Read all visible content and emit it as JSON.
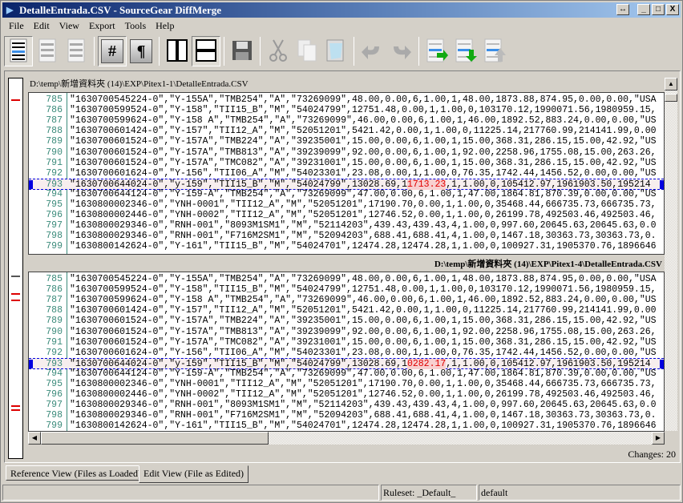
{
  "window": {
    "title": "DetalleEntrada.CSV - SourceGear DiffMerge",
    "buttons": [
      "↔",
      "_",
      "□",
      "X"
    ]
  },
  "menu": [
    "File",
    "Edit",
    "View",
    "Export",
    "Tools",
    "Help"
  ],
  "toolbar": [
    {
      "icon": "show-all-lines-icon",
      "pressed": true
    },
    {
      "icon": "show-diffs-only-icon",
      "pressed": false
    },
    {
      "icon": "show-diffs-context-icon",
      "pressed": false
    },
    {
      "icon": "line-numbers-icon",
      "label": "#",
      "pressed": true
    },
    {
      "icon": "pilcrow-icon",
      "label": "¶",
      "pressed": false
    },
    {
      "icon": "side-by-side-icon",
      "pressed": false
    },
    {
      "icon": "stacked-view-icon",
      "pressed": true
    },
    {
      "icon": "save-icon",
      "pressed": false
    },
    {
      "icon": "cut-icon",
      "pressed": false
    },
    {
      "icon": "copy-icon",
      "pressed": false
    },
    {
      "icon": "paste-icon",
      "pressed": false
    },
    {
      "icon": "undo-icon",
      "pressed": false
    },
    {
      "icon": "redo-icon",
      "pressed": false
    },
    {
      "icon": "apply-change-icon",
      "pressed": false
    },
    {
      "icon": "next-change-icon",
      "pressed": false
    },
    {
      "icon": "previous-change-icon",
      "pressed": false
    }
  ],
  "top_pane": {
    "path": "D:\\temp\\新增資料夾 (14)\\EXP\\Pitex1-1\\DetalleEntrada.CSV",
    "diff_value": "1713.23"
  },
  "bottom_pane": {
    "path": "D:\\temp\\新增資料夾 (14)\\EXP\\Pitex1-4\\DetalleEntrada.CSV",
    "diff_value": "0282.17"
  },
  "lines": [
    {
      "n": "785",
      "t": "\"1630700545224-0\",\"Y-155A\",\"TMB254\",\"A\",\"73269099\",48.00,0.00,6,1.00,1,48.00,1873.88,874.95,0.00,0.00,\"USA"
    },
    {
      "n": "786",
      "t": "\"1630700599524-0\",\"Y-158\",\"TII15_B\",\"M\",\"54024799\",12751.48,0.00,1,1.00,0,103170.12,1990071.56,1980959.15,"
    },
    {
      "n": "787",
      "t": "\"1630700599624-0\",\"Y-158 A\",\"TMB254\",\"A\",\"73269099\",46.00,0.00,6,1.00,1,46.00,1892.52,883.24,0.00,0.00,\"US"
    },
    {
      "n": "788",
      "t": "\"1630700601424-0\",\"Y-157\",\"TII12_A\",\"M\",\"52051201\",5421.42,0.00,1,1.00,0,11225.14,217760.99,214141.99,0.00"
    },
    {
      "n": "789",
      "t": "\"1630700601524-0\",\"Y-157A\",\"TMB224\",\"A\",\"39235001\",15.00,0.00,6,1.00,1,15.00,368.31,286.15,15.00,42.92,\"US"
    },
    {
      "n": "790",
      "t": "\"1630700601524-0\",\"Y-157A\",\"TMB813\",\"A\",\"39239099\",92.00,0.00,6,1.00,1,92.00,2258.96,1755.08,15.00,263.26,"
    },
    {
      "n": "791",
      "t": "\"1630700601524-0\",\"Y-157A\",\"TMC082\",\"A\",\"39231001\",15.00,0.00,6,1.00,1,15.00,368.31,286.15,15.00,42.92,\"US"
    },
    {
      "n": "792",
      "t": "\"1630700601624-0\",\"Y-156\",\"TII06_A\",\"M\",\"54023301\",23.08,0.00,1,1.00,0,76.35,1742.44,1456.52,0.00,0.00,\"US"
    },
    {
      "n": "793",
      "t": "\"1630700644024-0\",\"y-159\",\"TII15_B\",\"M\",\"54024799\",13028.69,1",
      "t2": ",1,1.00,0,105412.97,1961903.50,195214",
      "diff": true
    },
    {
      "n": "794",
      "t": "\"1630700644124-0\",\"Y-159-A\",\"TMB254\",\"A\",\"73269099\",47.00,0.00,6,1.00,1,47.00,1864.81,870.39,0.00,0.00,\"US"
    },
    {
      "n": "795",
      "t": "\"1630800002346-0\",\"YNH-0001\",\"TII12_A\",\"M\",\"52051201\",17190.70,0.00,1,1.00,0,35468.44,666735.73,666735.73,"
    },
    {
      "n": "796",
      "t": "\"1630800002446-0\",\"YNH-0002\",\"TII12_A\",\"M\",\"52051201\",12746.52,0.00,1,1.00,0,26199.78,492503.46,492503.46,"
    },
    {
      "n": "797",
      "t": "\"1630800029346-0\",\"RNH-001\",\"8093M1SM1\",\"M\",\"52114203\",439.43,439.43,4,1.00,0,997.60,20645.63,20645.63,0.0"
    },
    {
      "n": "798",
      "t": "\"1630800029346-0\",\"RNH-001\",\"F716M2SM1\",\"M\",\"52094203\",688.41,688.41,4,1.00,0,1467.18,30363.73,30363.73,0."
    },
    {
      "n": "799",
      "t": "\"1630800142624-0\",\"Y-161\",\"TII15_B\",\"M\",\"54024701\",12474.28,12474.28,1,1.00,0,100927.31,1905370.76,1896646"
    }
  ],
  "changes": "Changes: 20",
  "tabs": [
    "Reference View (Files as Loaded)",
    "Edit View (File as Edited)"
  ],
  "status": {
    "ruleset": "Ruleset: _Default_",
    "mode": "default"
  }
}
